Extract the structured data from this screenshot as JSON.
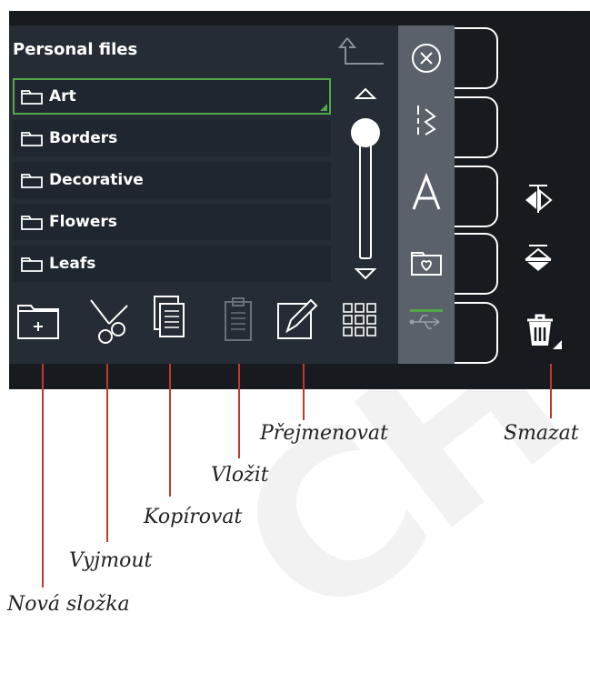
{
  "panel": {
    "title": "Personal files",
    "folders": [
      {
        "label": "Art",
        "selected": true
      },
      {
        "label": "Borders",
        "selected": false
      },
      {
        "label": "Decorative",
        "selected": false
      },
      {
        "label": "Flowers",
        "selected": false
      },
      {
        "label": "Leafs",
        "selected": false
      }
    ]
  },
  "sidebar": {
    "items": [
      "close-icon",
      "stitch-icon",
      "font-icon",
      "personal-files-icon",
      "usb-icon"
    ],
    "active": "personal-files-icon"
  },
  "toolbar": {
    "tools": [
      "new-folder-icon",
      "cut-icon",
      "copy-icon",
      "paste-icon",
      "rename-icon",
      "grid-view-icon"
    ]
  },
  "right_icons": [
    "mirror-horizontal-icon",
    "mirror-vertical-icon",
    "delete-icon"
  ],
  "callouts": {
    "new_folder": "Nová složka",
    "cut": "Vyjmout",
    "copy": "Kopírovat",
    "paste": "Vložit",
    "rename": "Přejmenovat",
    "delete": "Smazat"
  },
  "colors": {
    "accent": "#53a84a",
    "panel_bg": "#262c35",
    "row_bg": "#1f2630",
    "sidebar_bg": "#5a616b",
    "device_bg": "#171a1f",
    "callout_line": "#c0392b"
  },
  "watermark": "CH"
}
